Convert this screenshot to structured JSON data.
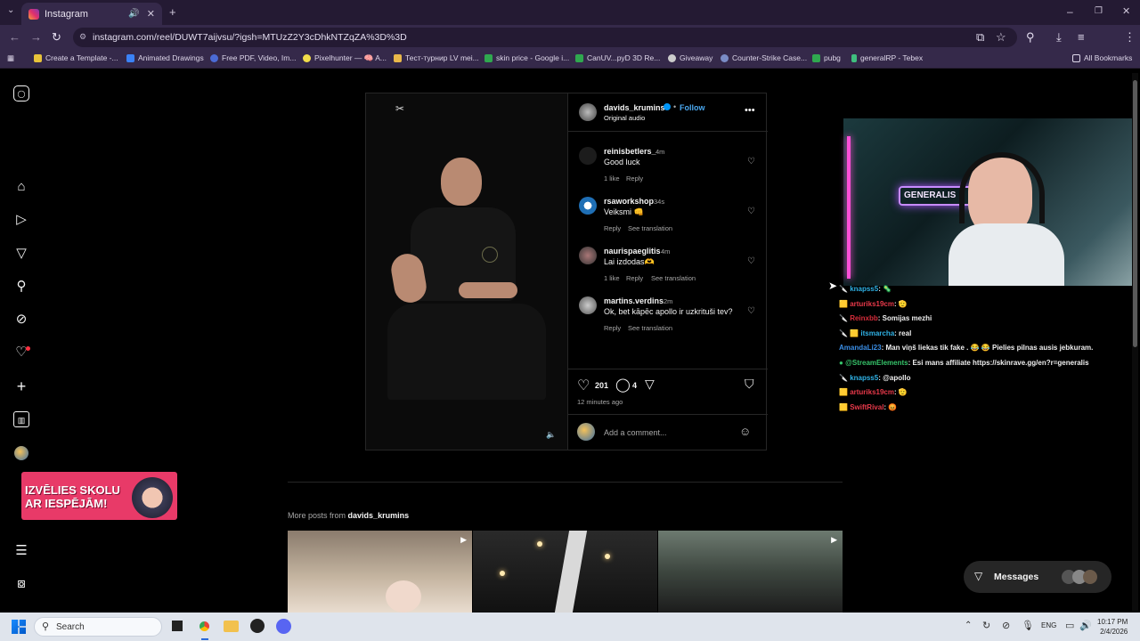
{
  "browser": {
    "tab_title": "Instagram",
    "url": "instagram.com/reel/DUWT7aijvsu/?igsh=MTUzZ2Y3cDhkNTZqZA%3D%3D",
    "bookmarks": [
      "Create a Template -...",
      "Animated Drawings",
      "Free PDF, Video, Im...",
      "Pixelhunter — 🧠 A...",
      "Тест-турнир LV mei...",
      "skin price - Google i...",
      "CanUV...pyD 3D Re...",
      "Giveaway",
      "Counter-Strike Case...",
      "pubg",
      "generalRP - Tebex"
    ],
    "all_bookmarks": "All Bookmarks"
  },
  "post": {
    "author": "davids_krumins",
    "follow": "Follow",
    "audio": "Original audio",
    "comments": [
      {
        "user": "reinisbetlers_",
        "time": "4m",
        "text": "Good luck",
        "likes": "1 like",
        "reply": "Reply",
        "translate": ""
      },
      {
        "user": "rsaworkshop",
        "time": "34s",
        "text": "Veiksmi 👊",
        "likes": "",
        "reply": "Reply",
        "translate": "See translation"
      },
      {
        "user": "naurispaeglitis",
        "time": "4m",
        "text": "Lai izdodas🫶",
        "likes": "1 like",
        "reply": "Reply",
        "translate": "See translation"
      },
      {
        "user": "martins.verdins",
        "time": "2m",
        "text": "Ok, bet kāpēc apollo ir uzkrituši tev?",
        "likes": "",
        "reply": "Reply",
        "translate": "See translation"
      }
    ],
    "like_count": "201",
    "comment_count": "4",
    "posted": "12 minutes ago",
    "add_comment": "Add a comment..."
  },
  "more_posts": {
    "prefix": "More posts from",
    "user": "davids_krumins"
  },
  "banner": {
    "line1": "IZVĒLIES SKOLU",
    "line2": "AR IESPĒJĀM!"
  },
  "chat": [
    {
      "user": "knapss5",
      "text": ": 🦠",
      "color": "#2fb2e6"
    },
    {
      "user": "arturiks19cm",
      "text": ": 🫡",
      "color": "#e8394a"
    },
    {
      "user": "Reinxbb",
      "text": ": Somijas mezhi",
      "color": "#d92d3b"
    },
    {
      "user": "itsmarcha",
      "text": ": real",
      "color": "#2fb2e6"
    },
    {
      "user": "AmandaLi23",
      "text": ": Man viņš liekas tik fake . 😂 😂 Pielies pilnas ausis jebkuram.",
      "color": "#3a8ee6"
    },
    {
      "user": "@StreamElements",
      "text": ": Esi mans affiliate https://skinrave.gg/en?r=generalis",
      "color": "#36c46a"
    },
    {
      "user": "knapss5",
      "text": ": @apollo",
      "color": "#2fb2e6"
    },
    {
      "user": "arturiks19cm",
      "text": ": 🫡",
      "color": "#e8394a"
    },
    {
      "user": "SwiftRival",
      "text": ": 😡",
      "color": "#e8394a"
    }
  ],
  "cam_sign": "GENERALIS",
  "messages": "Messages",
  "taskbar": {
    "search": "Search",
    "lang": "ENG",
    "time": "10:17 PM",
    "date": "2/4/2026"
  }
}
